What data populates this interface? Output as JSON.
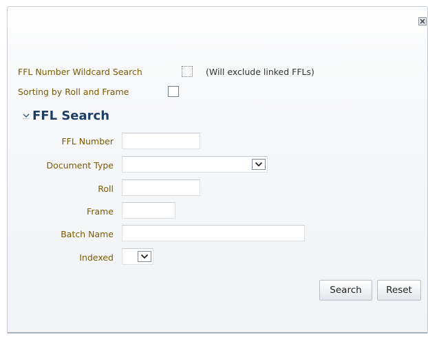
{
  "dialog": {
    "wildcard_label": "FFL Number Wildcard Search",
    "wildcard_note": "(Will exclude linked FFLs)",
    "sorting_label": "Sorting by Roll and Frame"
  },
  "section": {
    "title": "FFL Search",
    "expanded": true
  },
  "fields": {
    "ffl_number": {
      "label": "FFL Number",
      "value": ""
    },
    "document_type": {
      "label": "Document Type",
      "value": ""
    },
    "roll": {
      "label": "Roll",
      "value": ""
    },
    "frame": {
      "label": "Frame",
      "value": ""
    },
    "batch_name": {
      "label": "Batch Name",
      "value": ""
    },
    "indexed": {
      "label": "Indexed",
      "value": ""
    }
  },
  "buttons": {
    "search": "Search",
    "reset": "Reset"
  },
  "icons": {
    "close": "close-icon",
    "disclose": "chevron-down-icon",
    "dropdown": "dropdown-arrow-icon"
  },
  "colors": {
    "label": "#7a5a00",
    "section_title": "#1e3e66"
  }
}
